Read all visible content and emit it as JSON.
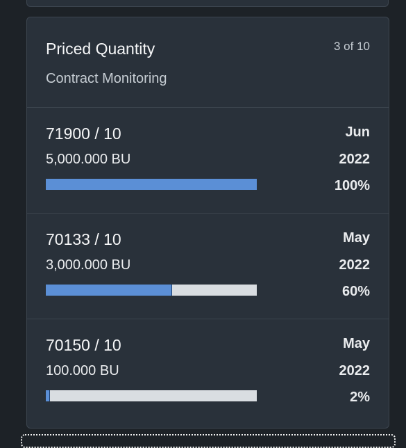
{
  "card": {
    "title": "Priced Quantity",
    "subtitle": "Contract Monitoring",
    "counter": "3 of 10"
  },
  "items": [
    {
      "title": "71900 / 10",
      "quantity": "5,000.000 BU",
      "month": "Jun",
      "year": "2022",
      "percent_label": "100%",
      "progress": 100
    },
    {
      "title": "70133 / 10",
      "quantity": "3,000.000 BU",
      "month": "May",
      "year": "2022",
      "percent_label": "60%",
      "progress": 60
    },
    {
      "title": "70150 / 10",
      "quantity": "100.000 BU",
      "month": "May",
      "year": "2022",
      "percent_label": "2%",
      "progress": 2
    }
  ],
  "colors": {
    "bar_fill": "#5b8fd6",
    "bar_track": "#d9dde1",
    "card_bg": "#29313a",
    "page_bg": "#1d2227"
  }
}
